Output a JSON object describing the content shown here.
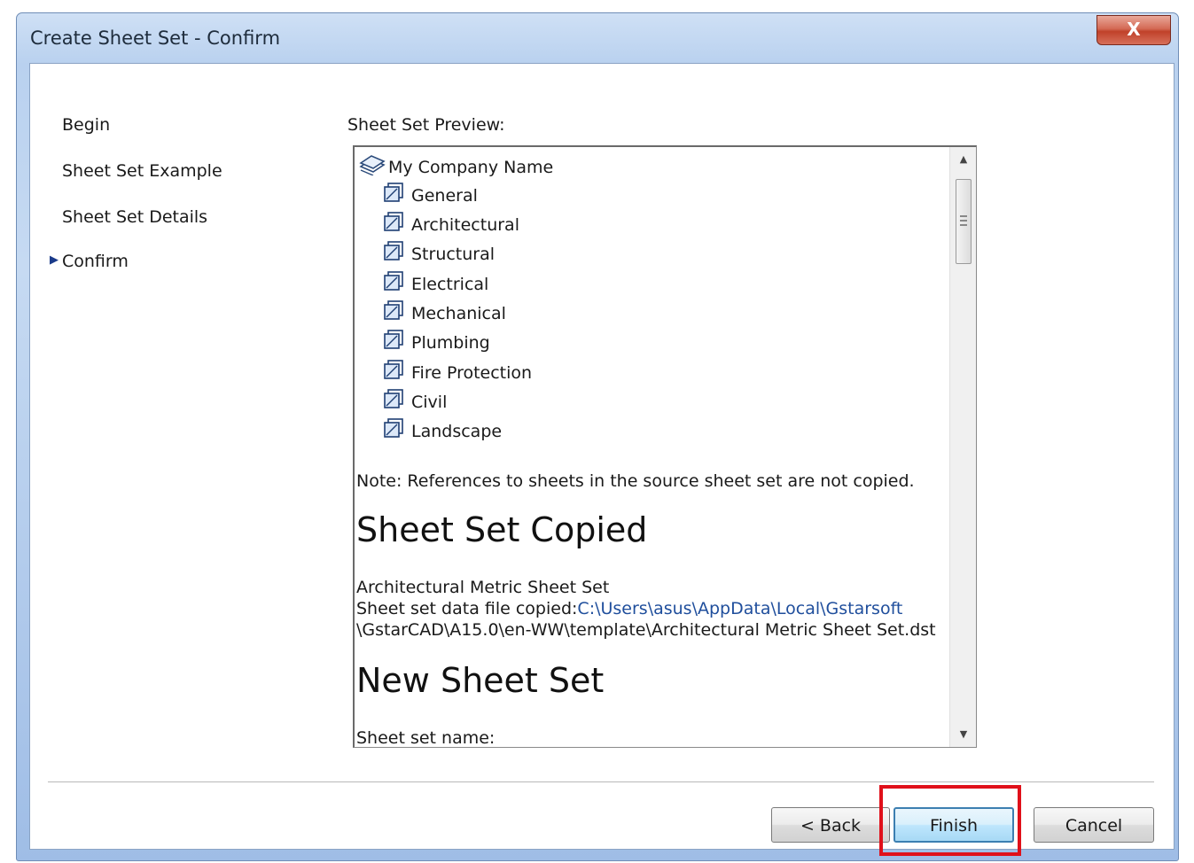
{
  "window": {
    "title": "Create Sheet Set - Confirm",
    "close_label": "X"
  },
  "nav": {
    "items": [
      {
        "label": "Begin"
      },
      {
        "label": "Sheet Set Example"
      },
      {
        "label": "Sheet Set Details"
      },
      {
        "label": "Confirm",
        "current": true
      }
    ],
    "current_marker": "▶"
  },
  "preview": {
    "label": "Sheet Set Preview:",
    "root": "My Company Name",
    "subsets": [
      "General",
      "Architectural",
      "Structural",
      "Electrical",
      "Mechanical",
      "Plumbing",
      "Fire Protection",
      "Civil",
      "Landscape"
    ],
    "note": "Note: References to sheets in the source sheet set are not copied.",
    "copied_heading": "Sheet Set Copied",
    "copied_link": "Architectural Metric Sheet Set",
    "data_file_label": "Sheet set data file copied:",
    "data_file_path_1": "C:\\Users\\asus\\AppData\\Local\\Gstarsoft",
    "data_file_path_2": "\\GstarCAD\\A15.0\\en-WW\\template\\Architectural Metric Sheet Set.dst",
    "new_heading": "New Sheet Set",
    "sheet_set_name_label": "Sheet set name:"
  },
  "buttons": {
    "back": "< Back",
    "finish": "Finish",
    "cancel": "Cancel"
  },
  "colors": {
    "link": "#1f4e9c",
    "highlight": "#e0101a",
    "title_bar": "#c6daf2"
  }
}
